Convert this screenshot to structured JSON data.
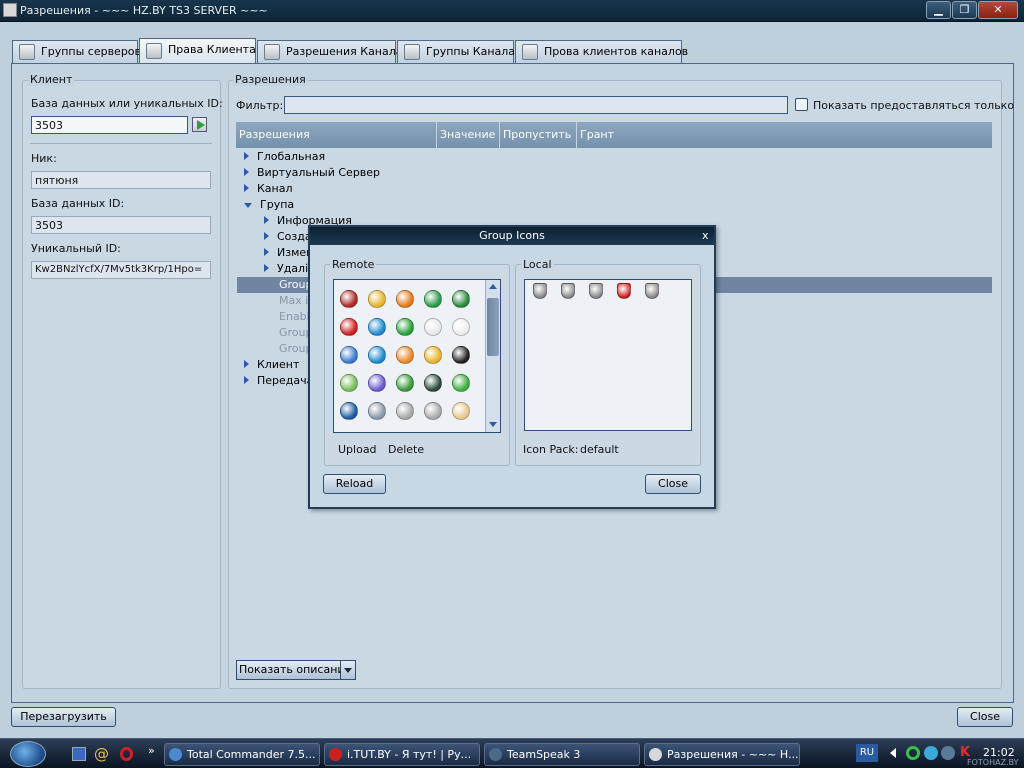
{
  "window": {
    "title": "Разрешения - ~~~ HZ.BY TS3 SERVER ~~~",
    "minimize": "▁",
    "maximize": "❐",
    "close": "✕"
  },
  "tabs": [
    {
      "label": "Группы серверов",
      "icon": "server-groups-icon"
    },
    {
      "label": "Права Клиента",
      "icon": "client-rights-icon"
    },
    {
      "label": "Разрешения Канала",
      "icon": "channel-perms-icon"
    },
    {
      "label": "Группы Канала",
      "icon": "channel-groups-icon"
    },
    {
      "label": "Прова клиентов каналов",
      "icon": "channel-client-perms-icon"
    }
  ],
  "client_panel": {
    "legend": "Клиент",
    "db_or_uid_label": "База данных или уникальных  ID:",
    "db_or_uid_value": "3503",
    "nick_label": "Ник:",
    "nick_value": "пятюня",
    "db_id_label": "База данных ID:",
    "db_id_value": "3503",
    "uid_label": "Уникальный ID:",
    "uid_value": "Kw2BNzlYcfX/7Mv5tk3Krp/1Hpo="
  },
  "perms_panel": {
    "legend": "Разрешения",
    "filter_label": "Фильтр:",
    "filter_value": "",
    "show_granted_label": "Показать предоставляться только",
    "columns": [
      "Разрешения",
      "Значение",
      "Пропустить",
      "Грант"
    ],
    "tree": [
      {
        "label": "Глобальная",
        "level": 0,
        "expanded": false
      },
      {
        "label": "Виртуальный Сервер",
        "level": 0,
        "expanded": false
      },
      {
        "label": "Канал",
        "level": 0,
        "expanded": false
      },
      {
        "label": "Група",
        "level": 0,
        "expanded": true
      },
      {
        "label": "Информация",
        "level": 1,
        "expanded": false
      },
      {
        "label": "Созда",
        "level": 1,
        "expanded": false
      },
      {
        "label": "Измен",
        "level": 1,
        "expanded": false
      },
      {
        "label": "Удалі",
        "level": 1,
        "expanded": false
      },
      {
        "label": "Group",
        "level": 1,
        "leaf": true,
        "selected": true
      },
      {
        "label": "Max ic",
        "level": 1,
        "leaf": true,
        "disabled": true
      },
      {
        "label": "Enable",
        "level": 1,
        "leaf": true,
        "disabled": true
      },
      {
        "label": "Group",
        "level": 1,
        "leaf": true,
        "disabled": true
      },
      {
        "label": "Group",
        "level": 1,
        "leaf": true,
        "disabled": true
      },
      {
        "label": "Клиент",
        "level": 0,
        "expanded": false
      },
      {
        "label": "Передача",
        "level": 0,
        "expanded": false
      }
    ],
    "show_description_label": "Показать описание"
  },
  "footer": {
    "reload_label": "Перезагрузить",
    "close_label": "Close"
  },
  "dialog": {
    "title": "Group Icons",
    "close": "x",
    "remote_legend": "Remote",
    "local_legend": "Local",
    "upload_label": "Upload",
    "delete_label": "Delete",
    "icon_pack_label": "Icon Pack:",
    "icon_pack_value": "default",
    "reload_label": "Reload",
    "close_label": "Close",
    "remote_icons": [
      {
        "name": "star-burst-icon",
        "color": "#b02828"
      },
      {
        "name": "sticky-note-icon",
        "color": "#e8b42a"
      },
      {
        "name": "rss-icon",
        "color": "#e87a1c"
      },
      {
        "name": "document-green-icon",
        "color": "#2a9a4a"
      },
      {
        "name": "excel-icon",
        "color": "#2b8a3e"
      },
      {
        "name": "skype-red-icon",
        "color": "#cc2020"
      },
      {
        "name": "skype-blue-icon",
        "color": "#1e8ad0"
      },
      {
        "name": "skype-green-icon",
        "color": "#2aa03a"
      },
      {
        "name": "speech-bubble-icon",
        "color": "#e8e8e8"
      },
      {
        "name": "counter-strike-icon",
        "color": "#eeeeee"
      },
      {
        "name": "star-blue-icon",
        "color": "#3a7ad0"
      },
      {
        "name": "skype-icon",
        "color": "#1e8ad0"
      },
      {
        "name": "flower-icon",
        "color": "#e88a2a"
      },
      {
        "name": "drill-icon",
        "color": "#e8b42a"
      },
      {
        "name": "yin-yang-icon",
        "color": "#222222"
      },
      {
        "name": "gear-green-icon",
        "color": "#7abf5a"
      },
      {
        "name": "puzzle-icon",
        "color": "#6a5acf"
      },
      {
        "name": "plus-icon",
        "color": "#3a9a3a"
      },
      {
        "name": "soldier-icon",
        "color": "#2a4a3a"
      },
      {
        "name": "heart-green-icon",
        "color": "#3ab03a"
      },
      {
        "name": "eye-icon",
        "color": "#1e5aa0"
      },
      {
        "name": "computer-icon",
        "color": "#8a9aaa"
      },
      {
        "name": "minus-icon",
        "color": "#aaaaaa"
      },
      {
        "name": "settings-icon",
        "color": "#aaaaaa"
      },
      {
        "name": "cup-icon",
        "color": "#e8c890"
      }
    ],
    "local_icons": [
      {
        "name": "shield-gray-icon",
        "color": "#888888"
      },
      {
        "name": "shield-server-icon",
        "color": "#8a8a8a"
      },
      {
        "name": "shield-s-icon",
        "color": "#8a8a8a"
      },
      {
        "name": "shield-red-icon",
        "color": "#d02020"
      },
      {
        "name": "shield-v-icon",
        "color": "#8a8a8a"
      }
    ]
  },
  "taskbar": {
    "tasks": [
      {
        "label": "Total Commander 7.5...",
        "color": "#4a8ad0"
      },
      {
        "label": "i.TUT.BY - Я тут! | Ру...",
        "color": "#cc2020"
      },
      {
        "label": "TeamSpeak 3",
        "color": "#4a6a8a"
      },
      {
        "label": "Разрешения - ~~~ H...",
        "color": "#d8d8d8"
      }
    ],
    "language": "RU",
    "clock": "21:02",
    "watermark": "FOTOHAZ.BY"
  }
}
